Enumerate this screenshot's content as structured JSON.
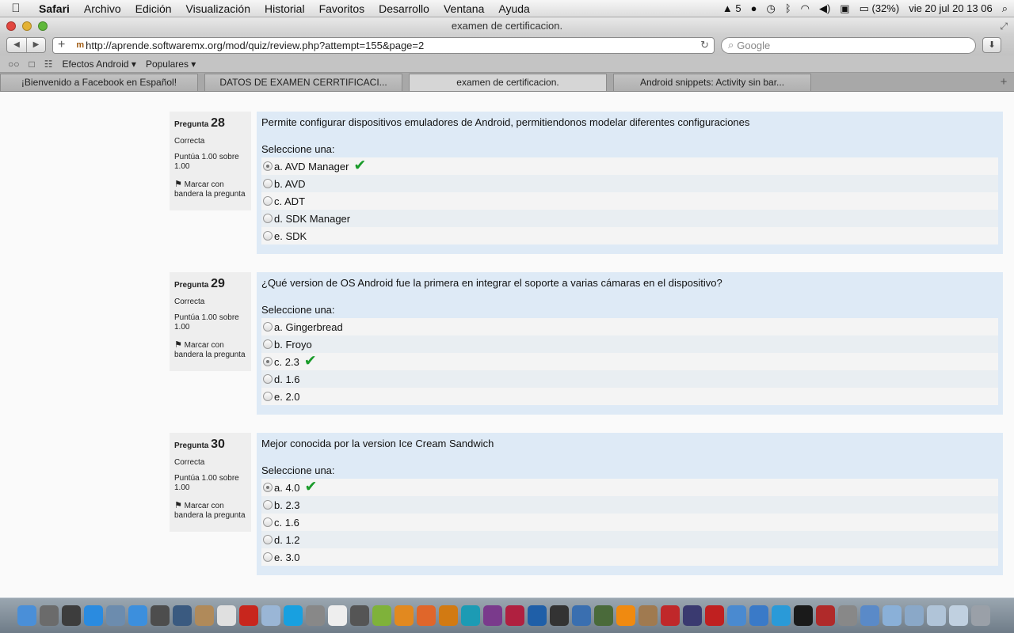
{
  "menubar": {
    "app": "Safari",
    "items": [
      "Archivo",
      "Edición",
      "Visualización",
      "Historial",
      "Favoritos",
      "Desarrollo",
      "Ventana",
      "Ayuda"
    ],
    "status": {
      "adobe_count": "5",
      "battery": "(32%)",
      "clock": "vie 20 jul  20 13 06"
    }
  },
  "window": {
    "title": "examen de certificacion.",
    "url": "http://aprende.softwaremx.org/mod/quiz/review.php?attempt=155&page=2",
    "search_placeholder": "Google",
    "bookmarks": [
      "Efectos Android ▾",
      "Populares ▾"
    ],
    "tabs": [
      {
        "label": "¡Bienvenido a Facebook en Español!"
      },
      {
        "label": "DATOS DE EXAMEN CERRTIFICACI..."
      },
      {
        "label": "examen de certificacion."
      },
      {
        "label": "Android snippets: Activity sin bar..."
      }
    ]
  },
  "quiz": {
    "question_label": "Pregunta",
    "state": "Correcta",
    "grade": "Puntúa 1.00 sobre 1.00",
    "flag_label": "Marcar con bandera la pregunta",
    "prompt": "Seleccione una:",
    "questions": [
      {
        "number": "28",
        "text": "Permite configurar dispositivos emuladores de Android, permitiendonos modelar diferentes configuraciones",
        "answers": [
          {
            "label": "a. AVD Manager",
            "selected": true,
            "correct": true
          },
          {
            "label": "b. AVD",
            "selected": false,
            "correct": false
          },
          {
            "label": "c. ADT",
            "selected": false,
            "correct": false
          },
          {
            "label": "d. SDK Manager",
            "selected": false,
            "correct": false
          },
          {
            "label": "e. SDK",
            "selected": false,
            "correct": false
          }
        ]
      },
      {
        "number": "29",
        "text": "¿Qué version de OS Android fue la primera en integrar el soporte a varias cámaras en el dispositivo?",
        "answers": [
          {
            "label": "a. Gingerbread",
            "selected": false,
            "correct": false
          },
          {
            "label": "b. Froyo",
            "selected": false,
            "correct": false
          },
          {
            "label": "c. 2.3",
            "selected": true,
            "correct": true
          },
          {
            "label": "d. 1.6",
            "selected": false,
            "correct": false
          },
          {
            "label": "e. 2.0",
            "selected": false,
            "correct": false
          }
        ]
      },
      {
        "number": "30",
        "text": "Mejor conocida por la version Ice Cream Sandwich",
        "answers": [
          {
            "label": "a. 4.0",
            "selected": true,
            "correct": true
          },
          {
            "label": "b. 2.3",
            "selected": false,
            "correct": false
          },
          {
            "label": "c. 1.6",
            "selected": false,
            "correct": false
          },
          {
            "label": "d. 1.2",
            "selected": false,
            "correct": false
          },
          {
            "label": "e. 3.0",
            "selected": false,
            "correct": false
          }
        ]
      }
    ]
  },
  "dock": {
    "apps": [
      {
        "name": "finder",
        "color": "#4a8fd8"
      },
      {
        "name": "launchpad",
        "color": "#6b6b6b"
      },
      {
        "name": "dashboard",
        "color": "#3d3d3d"
      },
      {
        "name": "app-store",
        "color": "#2a8be0"
      },
      {
        "name": "preview",
        "color": "#6c8cae"
      },
      {
        "name": "safari",
        "color": "#3c8fdd"
      },
      {
        "name": "facetime",
        "color": "#4d4d4d"
      },
      {
        "name": "xcode",
        "color": "#3a5a80"
      },
      {
        "name": "contacts",
        "color": "#b08a5a"
      },
      {
        "name": "calendar",
        "color": "#e0e0e0"
      },
      {
        "name": "filezilla",
        "color": "#c8261d"
      },
      {
        "name": "virtualbox-box",
        "color": "#9ab6d6"
      },
      {
        "name": "skype",
        "color": "#18a0e0"
      },
      {
        "name": "utility",
        "color": "#888"
      },
      {
        "name": "textedit",
        "color": "#eeeeee"
      },
      {
        "name": "photo-booth",
        "color": "#555"
      },
      {
        "name": "android",
        "color": "#7fb23a"
      },
      {
        "name": "blender",
        "color": "#e2891f"
      },
      {
        "name": "firefox",
        "color": "#e0662a"
      },
      {
        "name": "illustrator",
        "color": "#d27a12"
      },
      {
        "name": "web-tool",
        "color": "#1c9bb4"
      },
      {
        "name": "system-app",
        "color": "#7a3a8c"
      },
      {
        "name": "game",
        "color": "#b02040"
      },
      {
        "name": "photoshop",
        "color": "#1f5fa8"
      },
      {
        "name": "unity",
        "color": "#333"
      },
      {
        "name": "virtualbox",
        "color": "#3a6fb0"
      },
      {
        "name": "misc",
        "color": "#4a6a3a"
      },
      {
        "name": "vlc",
        "color": "#f08a10"
      },
      {
        "name": "gimp",
        "color": "#a07a50"
      },
      {
        "name": "angry-birds",
        "color": "#c0282a"
      },
      {
        "name": "eclipse",
        "color": "#3a3a70"
      },
      {
        "name": "terminal-tool",
        "color": "#c02020"
      },
      {
        "name": "instruments",
        "color": "#4a8ad0"
      },
      {
        "name": "itunes",
        "color": "#3a7ac8"
      },
      {
        "name": "twitter",
        "color": "#2a9ad8"
      },
      {
        "name": "terminal",
        "color": "#1a1a1a"
      },
      {
        "name": "photo-app",
        "color": "#b02a2a"
      },
      {
        "name": "settings",
        "color": "#888"
      },
      {
        "name": "xcode-tool",
        "color": "#5a8ac8"
      },
      {
        "name": "folder",
        "color": "#8ab0d8"
      },
      {
        "name": "downloads",
        "color": "#8aa8c8"
      },
      {
        "name": "documents",
        "color": "#b0c4d8"
      },
      {
        "name": "documents-2",
        "color": "#c0d0e0"
      },
      {
        "name": "trash",
        "color": "#9aa0a8"
      }
    ]
  }
}
